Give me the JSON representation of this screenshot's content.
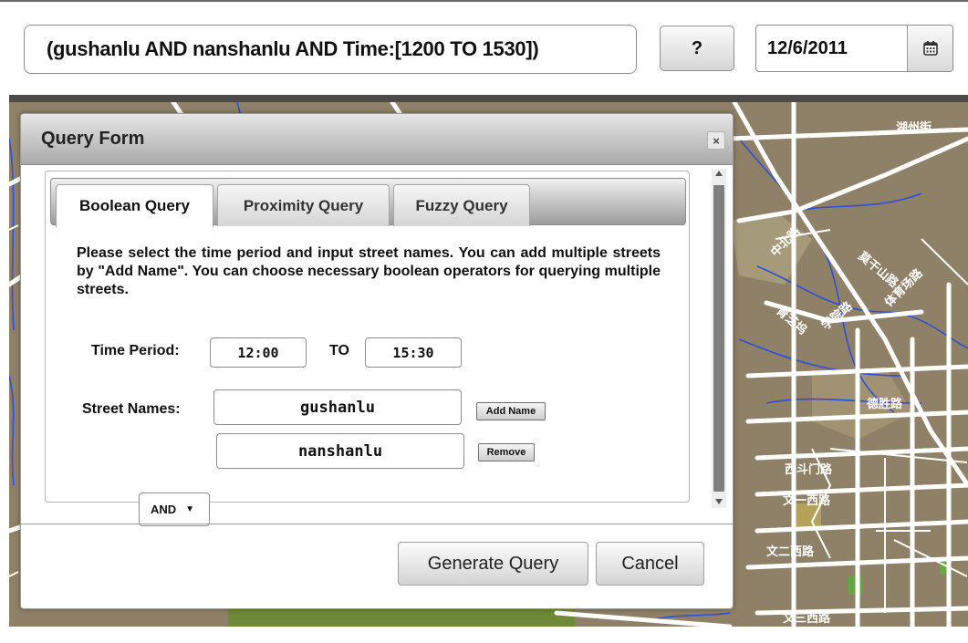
{
  "toolbar": {
    "query_text": "(gushanlu AND nanshanlu AND Time:[1200 TO 1530])",
    "help_label": "?",
    "date_value": "12/6/2011",
    "calendar_icon": "calendar-icon"
  },
  "map": {
    "labels": [
      "湖州街",
      "中北路",
      "莫干山路",
      "青芝坞",
      "学院路",
      "体育场路",
      "西斗门路",
      "文一西路",
      "文二西路",
      "文三西路",
      "德胜路"
    ]
  },
  "dialog": {
    "title": "Query Form",
    "close_label": "×",
    "tabs": [
      {
        "label": "Boolean Query",
        "active": true
      },
      {
        "label": "Proximity Query",
        "active": false
      },
      {
        "label": "Fuzzy Query",
        "active": false
      }
    ],
    "description": "Please select the time period and input street names. You can add multiple streets by \"Add Name\". You can choose necessary boolean operators for querying multiple streets.",
    "time_period_label": "Time Period:",
    "time_from": "12:00",
    "time_to_label": "TO",
    "time_to": "15:30",
    "street_names_label": "Street Names:",
    "street_1": "gushanlu",
    "add_name_label": "Add Name",
    "operator": "AND",
    "street_2": "nanshanlu",
    "remove_label": "Remove",
    "generate_label": "Generate Query",
    "cancel_label": "Cancel"
  }
}
